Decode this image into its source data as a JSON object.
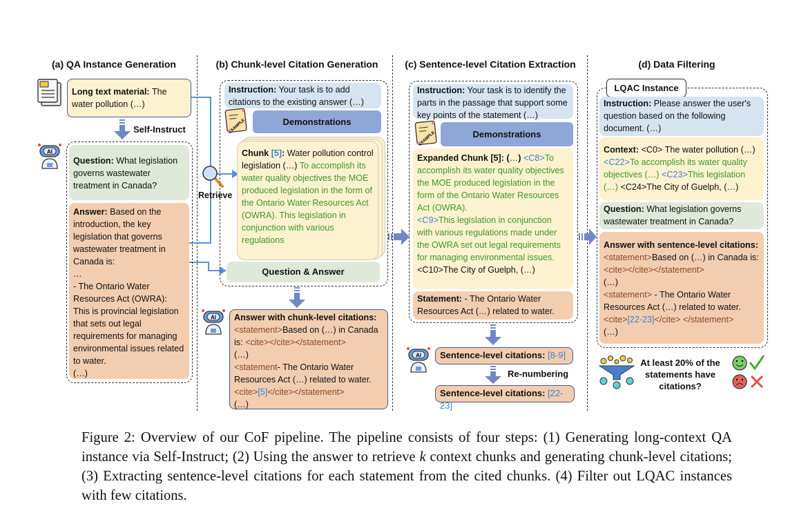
{
  "palette": {
    "cite_blue": "#3f7fcf",
    "green_text": "#3a9a2a",
    "tag_brown": "#8a4a26",
    "arrow": "#7288c4",
    "line": "#5b8fd6",
    "yellow": "#fdf2cf",
    "green": "#dfe9d9",
    "orange": "#f3cdb0",
    "blue": "#d6e3f1",
    "demo": "#8fa6d8"
  },
  "icons": [
    "document-icon",
    "robot-ai-icon",
    "magnifier-icon",
    "example-paper-icon",
    "funnel-icon",
    "happy-face-icon",
    "check-icon",
    "sad-face-icon",
    "cross-icon"
  ],
  "sections": {
    "a": {
      "title": "(a) QA Instance Generation",
      "long_text": [
        {
          "t": "Long text material:",
          "s": "b"
        },
        {
          "t": " The water pollution (…)"
        }
      ],
      "self_instruct": "Self-Instruct",
      "question": [
        {
          "t": "Question:",
          "s": "b"
        },
        {
          "t": " What legislation governs wastewater treatment in Canada?"
        }
      ],
      "answer": [
        {
          "t": "Answer:",
          "s": "b"
        },
        {
          "t": " Based on the introduction, the key legislation that governs wastewater treatment in Canada is:"
        },
        {
          "t": "\n…\n"
        },
        {
          "t": "- The Ontario Water Resources Act (OWRA): This is provincial legislation that sets out legal requirements for managing environmental issues related to water."
        },
        {
          "t": "\n(…)"
        }
      ]
    },
    "b": {
      "title": "(b) Chunk-level Citation Generation",
      "retrieve": "Retrieve",
      "instruction": [
        {
          "t": "Instruction:",
          "s": "b"
        },
        {
          "t": " Your task is to add citations to the existing answer (…)"
        }
      ],
      "demonstrations": "Demonstrations",
      "example_icon_text": "EXAMPLE",
      "chunk": [
        {
          "t": "Chunk ",
          "s": "b"
        },
        {
          "t": "[5]",
          "s": "cb"
        },
        {
          "t": ":",
          "s": "b"
        },
        {
          "t": " Water pollution control legislation (…) "
        },
        {
          "t": "To accomplish its water quality objectives the MOE produced legislation in the form of the Ontario Water Resources Act (OWRA).  This legislation in conjunction with various regulations",
          "s": "g"
        }
      ],
      "qa": "Question & Answer",
      "answer_chunk": [
        {
          "t": "Answer with chunk-level citations:",
          "s": "b"
        },
        {
          "t": "\n"
        },
        {
          "t": "<statement>",
          "s": "r"
        },
        {
          "t": "Based on (…) in Canada is: "
        },
        {
          "t": "<cite></cite></statement>",
          "s": "r"
        },
        {
          "t": "\n(…)\n"
        },
        {
          "t": "<statement",
          "s": "r"
        },
        {
          "t": "- The Ontario Water Resources Act (…) related to water."
        },
        {
          "t": "<cite>",
          "s": "r"
        },
        {
          "t": "[5]",
          "s": "c"
        },
        {
          "t": "</cite></statement>",
          "s": "r"
        },
        {
          "t": "\n(…)"
        }
      ]
    },
    "c": {
      "title": "(c) Sentence-level Citation Extraction",
      "instruction": [
        {
          "t": "Instruction:",
          "s": "b"
        },
        {
          "t": " Your task is to identify the parts in the passage that support some key points of the statement (…)"
        }
      ],
      "demonstrations": "Demonstrations",
      "expanded": [
        {
          "t": "Expanded Chunk [5]: (",
          "s": "b"
        },
        {
          "t": "…"
        },
        {
          "t": ")",
          "s": "b"
        },
        {
          "t": " <C8>",
          "s": "c"
        },
        {
          "t": "To accomplish its water quality objectives the MOE produced legislation in the form of the Ontario Water Resources Act (OWRA).",
          "s": "g"
        },
        {
          "t": "\n"
        },
        {
          "t": "<C9>",
          "s": "c"
        },
        {
          "t": "This legislation in conjunction with various regulations made under the OWRA set out legal requirements for managing environmental issues.",
          "s": "g"
        },
        {
          "t": " <C10>The City of Guelph, (…)"
        }
      ],
      "statement": [
        {
          "t": "Statement:",
          "s": "b"
        },
        {
          "t": " - The Ontario Water Resources Act (…) related to water."
        }
      ],
      "sent_cit_1": [
        {
          "t": "Sentence-level citations: ",
          "s": "b"
        },
        {
          "t": "[8-9]",
          "s": "c"
        }
      ],
      "renumbering": "Re-numbering",
      "sent_cit_2": [
        {
          "t": "Sentence-level citations: ",
          "s": "b"
        },
        {
          "t": "[22-23]",
          "s": "c"
        }
      ]
    },
    "d": {
      "title": "(d) Data Filtering",
      "lqac": "LQAC Instance",
      "instruction": [
        {
          "t": "Instruction:",
          "s": "b"
        },
        {
          "t": " Please answer the user's question based on the following document. (…)"
        }
      ],
      "context": [
        {
          "t": "Context:",
          "s": "b"
        },
        {
          "t": " <C0> The water pollution (…) "
        },
        {
          "t": "<C22>",
          "s": "c"
        },
        {
          "t": "To accomplish its water quality objectives (…) ",
          "s": "g"
        },
        {
          "t": "<C23>",
          "s": "c"
        },
        {
          "t": "This legislation (…)",
          "s": "g"
        },
        {
          "t": " <C24>The City of Guelph, (…)"
        }
      ],
      "question": [
        {
          "t": "Question:",
          "s": "b"
        },
        {
          "t": " What legislation governs wastewater treatment in Canada?"
        }
      ],
      "answer": [
        {
          "t": "Answer with sentence-level citations:",
          "s": "b"
        },
        {
          "t": "\n"
        },
        {
          "t": "<statement>",
          "s": "r"
        },
        {
          "t": "Based on (…) in Canada is: "
        },
        {
          "t": "<cite></cite></statement>",
          "s": "r"
        },
        {
          "t": "\n(…)\n"
        },
        {
          "t": "<statement>",
          "s": "r"
        },
        {
          "t": " - The Ontario Water Resources Act (…) related to water. "
        },
        {
          "t": "<cite>",
          "s": "r"
        },
        {
          "t": "[22-23]",
          "s": "c"
        },
        {
          "t": "</cite> </statement>",
          "s": "r"
        },
        {
          "t": "\n(…)"
        }
      ],
      "filter_question": "At least 20% of the statements have citations?"
    }
  },
  "caption": [
    {
      "t": "Figure 2: Overview of our CoF pipeline. The pipeline consists of four steps: (1) Generating long-context QA instance via Self-Instruct; (2) Using the answer to retrieve "
    },
    {
      "t": "k",
      "s": "i"
    },
    {
      "t": " context chunks and generating chunk-level citations; (3) Extracting sentence-level citations for each statement from the cited chunks. (4) Filter out LQAC instances with few citations."
    }
  ]
}
